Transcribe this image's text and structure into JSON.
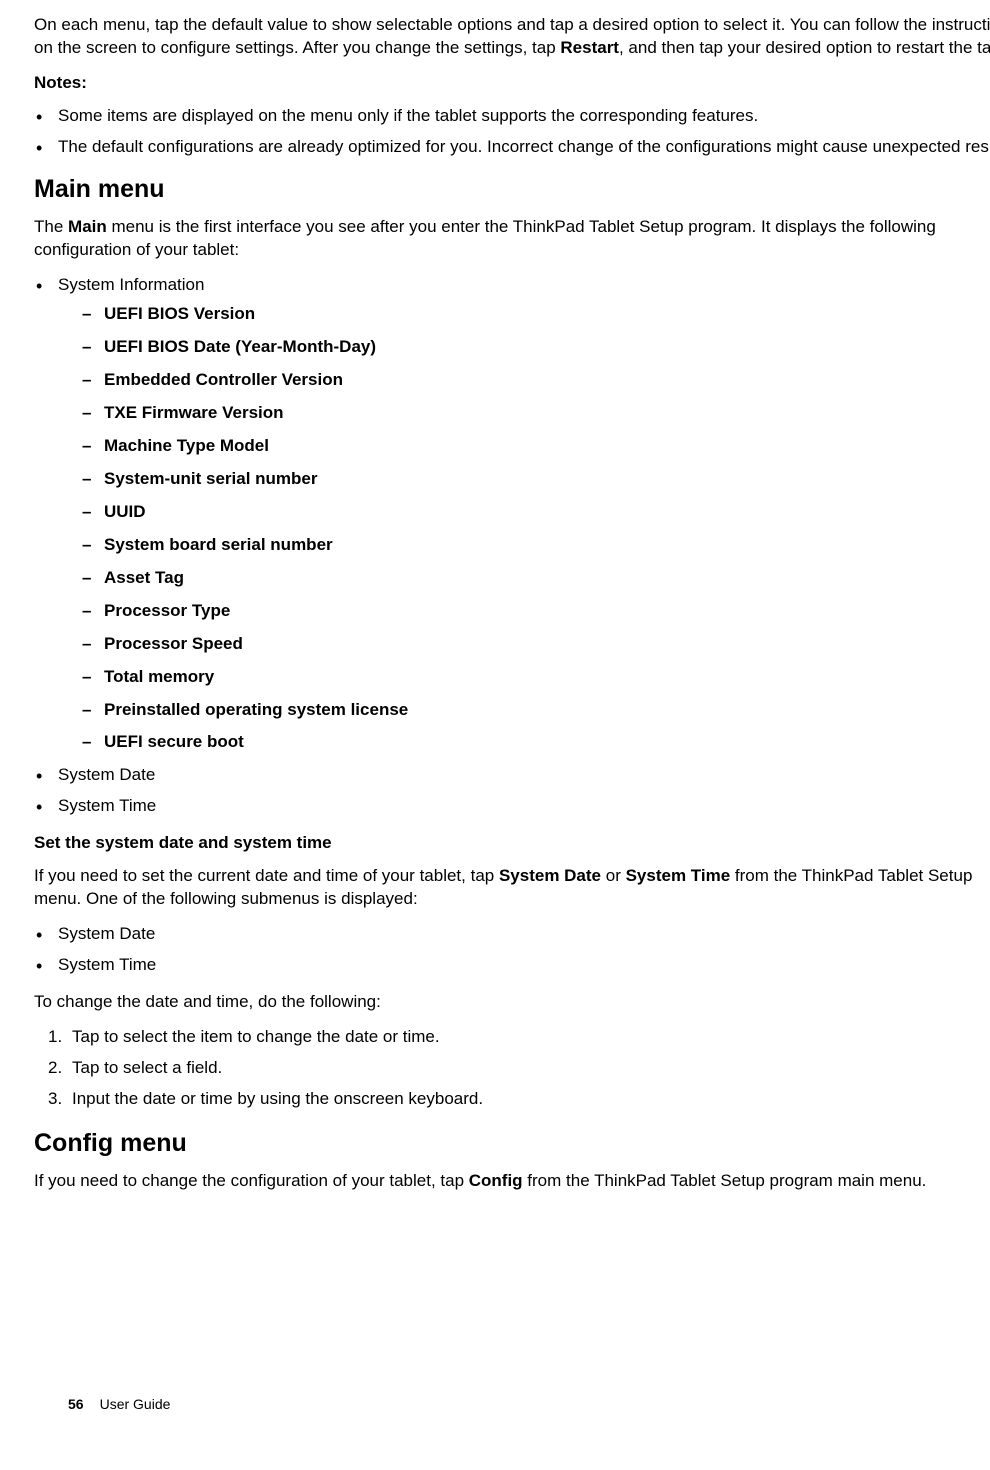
{
  "intro": {
    "p1_a": "On each menu, tap the default value to show selectable options and tap a desired option to select it. You can follow the instructions on the screen to configure settings. After you change the settings, tap ",
    "restart": "Restart",
    "p1_b": ", and then tap your desired option to restart the tablet.",
    "notes_label": "Notes:",
    "notes": [
      "Some items are displayed on the menu only if the tablet supports the corresponding features.",
      "The default configurations are already optimized for you. Incorrect change of the configurations might cause unexpected results."
    ]
  },
  "main_menu": {
    "heading": "Main menu",
    "p_a": "The ",
    "main_bold": "Main",
    "p_b": " menu is the first interface you see after you enter the ThinkPad Tablet Setup program. It displays the following configuration of your tablet:",
    "sysinfo_label": "System Information",
    "sysinfo_items": [
      "UEFI BIOS Version",
      "UEFI BIOS Date (Year-Month-Day)",
      "Embedded Controller Version",
      "TXE Firmware Version",
      "Machine Type Model",
      "System-unit serial number",
      "UUID",
      "System board serial number",
      "Asset Tag",
      "Processor Type",
      "Processor Speed",
      "Total memory",
      "Preinstalled operating system license",
      "UEFI secure boot"
    ],
    "system_date": "System Date",
    "system_time": "System Time"
  },
  "set_dt": {
    "subheading": "Set the system date and system time",
    "p_a": "If you need to set the current date and time of your tablet, tap ",
    "sd_bold": "System Date",
    "or": " or ",
    "st_bold": "System Time",
    "p_b": " from the ThinkPad Tablet Setup menu. One of the following submenus is displayed:",
    "submenu": [
      "System Date",
      "System Time"
    ],
    "change_intro": "To change the date and time, do the following:",
    "steps": [
      "Tap to select the item to change the date or time.",
      "Tap to select a field.",
      "Input the date or time by using the onscreen keyboard."
    ]
  },
  "config_menu": {
    "heading": "Config menu",
    "p_a": "If you need to change the configuration of your tablet, tap ",
    "config_bold": "Config",
    "p_b": " from the ThinkPad Tablet Setup program main menu."
  },
  "footer": {
    "page": "56",
    "title": "User Guide"
  }
}
